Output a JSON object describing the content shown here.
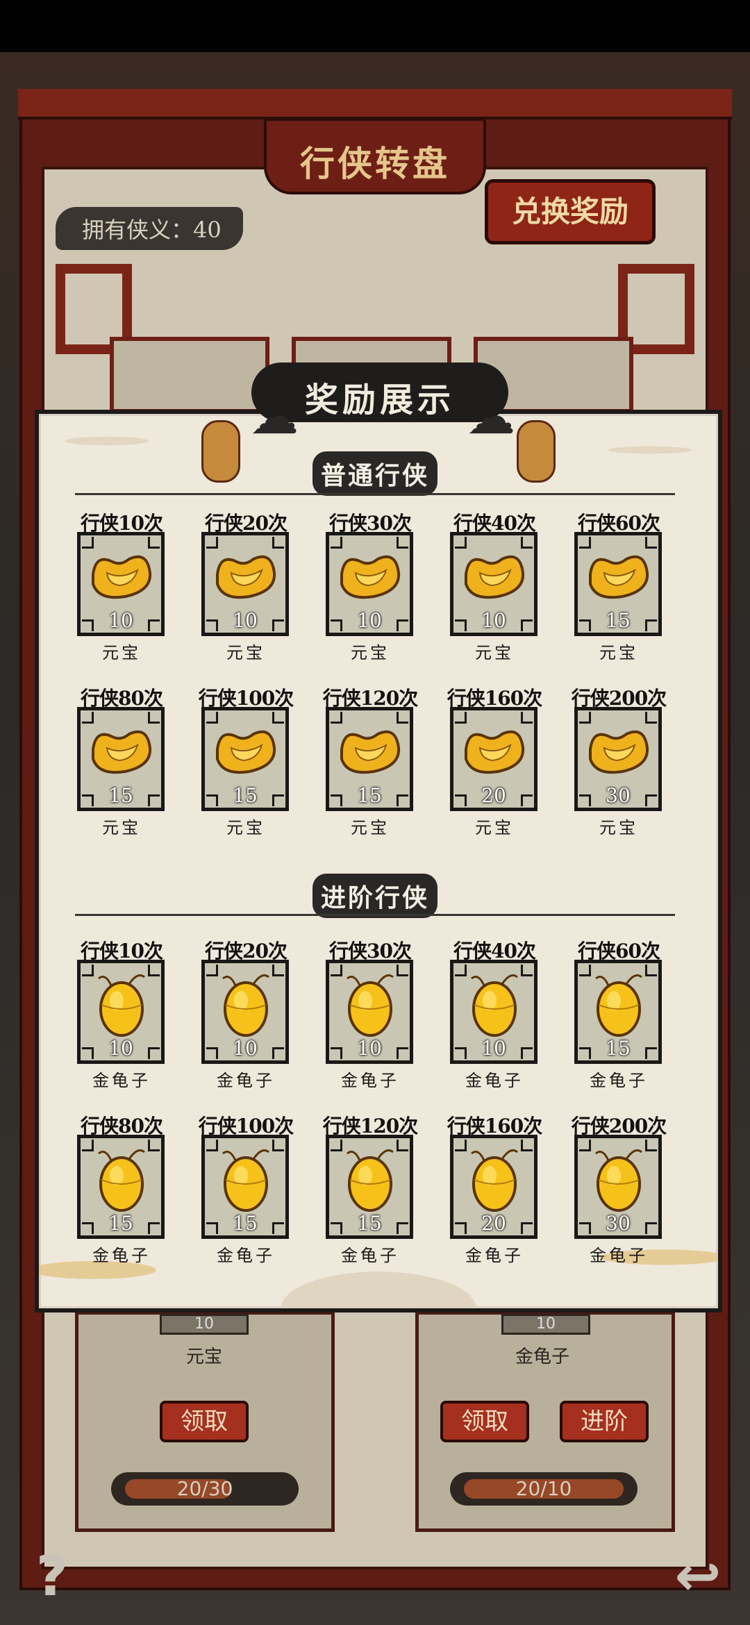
{
  "background": {
    "title": "行侠转盘",
    "currency_label": "拥有侠义：40",
    "exchange_button": "兑换奖励",
    "left_card": {
      "qty": "10",
      "name": "元宝",
      "claim_button": "领取",
      "progress": "20/30",
      "progress_fraction": 0.67
    },
    "right_card": {
      "qty": "10",
      "name": "金龟子",
      "claim_button": "领取",
      "advance_button": "进阶",
      "progress": "20/10",
      "progress_fraction": 1.0
    },
    "help_icon": "question-mark-icon",
    "back_icon": "return-arrow-icon"
  },
  "modal": {
    "title": "奖励展示",
    "sections": [
      {
        "title": "普通行侠",
        "item_name": "元宝",
        "icon": "gold-ingot-icon",
        "rewards": [
          {
            "cond": "行侠10次",
            "qty": "10"
          },
          {
            "cond": "行侠20次",
            "qty": "10"
          },
          {
            "cond": "行侠30次",
            "qty": "10"
          },
          {
            "cond": "行侠40次",
            "qty": "10"
          },
          {
            "cond": "行侠60次",
            "qty": "15"
          },
          {
            "cond": "行侠80次",
            "qty": "15"
          },
          {
            "cond": "行侠100次",
            "qty": "15"
          },
          {
            "cond": "行侠120次",
            "qty": "15"
          },
          {
            "cond": "行侠160次",
            "qty": "20"
          },
          {
            "cond": "行侠200次",
            "qty": "30"
          }
        ]
      },
      {
        "title": "进阶行侠",
        "item_name": "金龟子",
        "icon": "golden-beetle-icon",
        "rewards": [
          {
            "cond": "行侠10次",
            "qty": "10"
          },
          {
            "cond": "行侠20次",
            "qty": "10"
          },
          {
            "cond": "行侠30次",
            "qty": "10"
          },
          {
            "cond": "行侠40次",
            "qty": "10"
          },
          {
            "cond": "行侠60次",
            "qty": "15"
          },
          {
            "cond": "行侠80次",
            "qty": "15"
          },
          {
            "cond": "行侠100次",
            "qty": "15"
          },
          {
            "cond": "行侠120次",
            "qty": "15"
          },
          {
            "cond": "行侠160次",
            "qty": "20"
          },
          {
            "cond": "行侠200次",
            "qty": "30"
          }
        ]
      }
    ]
  },
  "colors": {
    "frame_red": "#7a2418",
    "gold": "#f0b21c",
    "ink": "#1a1816",
    "parchment": "#efe9dc"
  }
}
